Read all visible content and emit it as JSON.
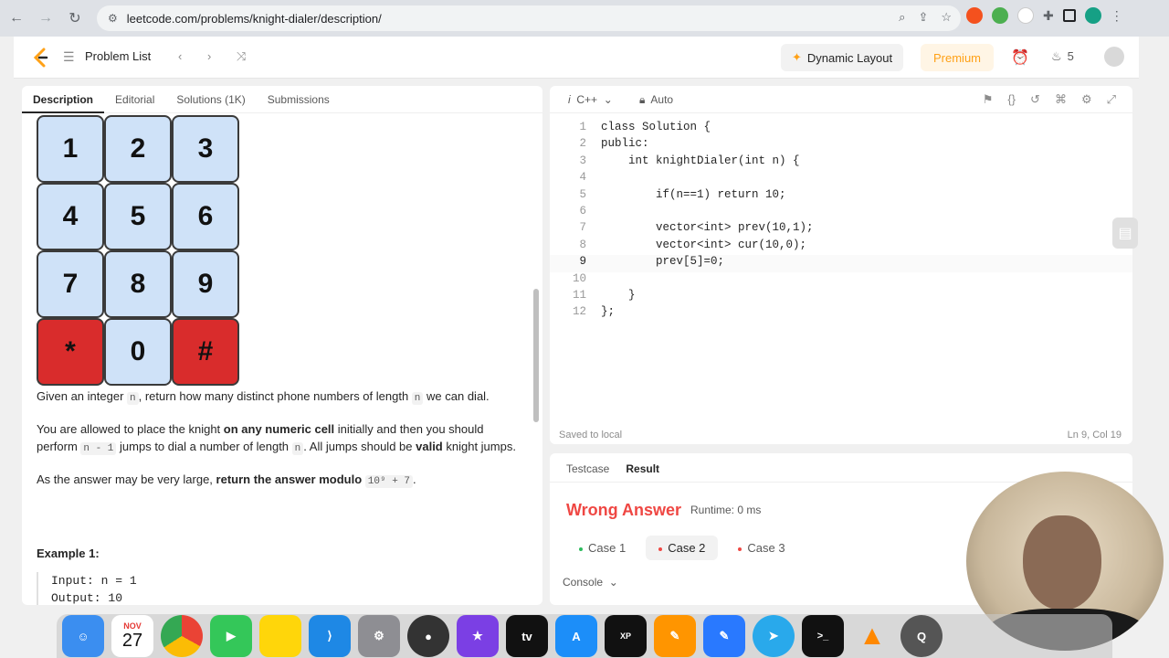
{
  "browser": {
    "url": "leetcode.com/problems/knight-dialer/description/"
  },
  "header": {
    "problem_list": "Problem List",
    "dynamic_layout": "Dynamic Layout",
    "premium": "Premium",
    "streak_count": "5"
  },
  "tabs": [
    "Description",
    "Editorial",
    "Solutions (1K)",
    "Submissions"
  ],
  "dialpad": [
    "1",
    "2",
    "3",
    "4",
    "5",
    "6",
    "7",
    "8",
    "9",
    "*",
    "0",
    "#"
  ],
  "description": {
    "p1_a": "Given an integer ",
    "p1_code1": "n",
    "p1_b": ", return how many distinct phone numbers of length ",
    "p1_code2": "n",
    "p1_c": " we can dial.",
    "p2_a": "You are allowed to place the knight ",
    "p2_bold": "on any numeric cell",
    "p2_b": " initially and then you should perform ",
    "p2_code1": "n - 1",
    "p2_c": " jumps to dial a number of length ",
    "p2_code2": "n",
    "p2_d": ". All jumps should be ",
    "p2_bold2": "valid",
    "p2_e": " knight jumps.",
    "p3_a": "As the answer may be very large, ",
    "p3_bold": "return the answer modulo",
    "p3_code": "10⁹ + 7",
    "p3_b": ".",
    "example_title": "Example 1:",
    "example_input": "Input: n = 1",
    "example_output": "Output: 10"
  },
  "editor": {
    "language": "C++",
    "mode": "Auto",
    "status_left": "Saved to local",
    "status_right": "Ln 9, Col 19"
  },
  "code_lines": [
    "class Solution {",
    "public:",
    "    int knightDialer(int n) {",
    "",
    "        if(n==1) return 10;",
    "",
    "        vector<int> prev(10,1);",
    "        vector<int> cur(10,0);",
    "        prev[5]=0;",
    "",
    "    }",
    "};"
  ],
  "result": {
    "tabs": [
      "Testcase",
      "Result"
    ],
    "status": "Wrong Answer",
    "runtime": "Runtime: 0 ms",
    "cases": [
      "Case 1",
      "Case 2",
      "Case 3"
    ],
    "console": "Console"
  },
  "dock": {
    "calendar_month": "NOV",
    "calendar_day": "27"
  },
  "colors": {
    "accent": "#ffa116",
    "error": "#ef4743",
    "key_blue": "#cfe2f8",
    "key_red": "#d92c2c"
  }
}
